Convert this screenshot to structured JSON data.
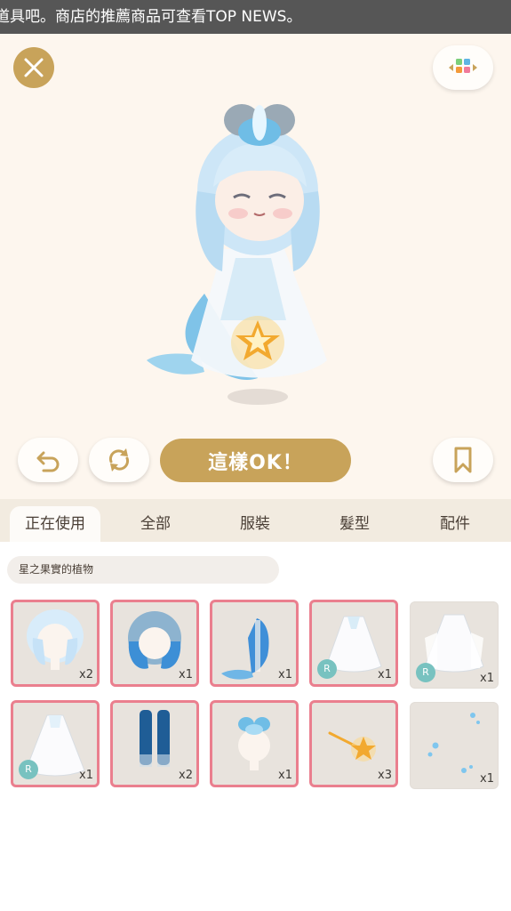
{
  "ticker": {
    "text": "道具吧。商店的推薦商品可查看TOP NEWS。"
  },
  "stage": {
    "close_icon": "close-icon",
    "palette_icon": "palette-grid-icon",
    "undo_icon": "undo-icon",
    "refresh_icon": "refresh-icon",
    "ok_label": "這樣OK！",
    "bookmark_icon": "bookmark-icon"
  },
  "tabs": [
    {
      "label": "正在使用",
      "active": true
    },
    {
      "label": "全部",
      "active": false
    },
    {
      "label": "服裝",
      "active": false
    },
    {
      "label": "髮型",
      "active": false
    },
    {
      "label": "配件",
      "active": false
    }
  ],
  "collection": {
    "label": "星之果實的植物"
  },
  "items": [
    {
      "kind": "hair-short-light",
      "count": "x2",
      "selected": true,
      "badge": ""
    },
    {
      "kind": "hair-blue-gradient",
      "count": "x1",
      "selected": true,
      "badge": ""
    },
    {
      "kind": "mermaid-tail",
      "count": "x1",
      "selected": true,
      "badge": ""
    },
    {
      "kind": "white-dress",
      "count": "x1",
      "selected": true,
      "badge": "R"
    },
    {
      "kind": "white-dress-alt",
      "count": "x1",
      "selected": false,
      "badge": "R"
    },
    {
      "kind": "sheer-gown",
      "count": "x1",
      "selected": true,
      "badge": "R"
    },
    {
      "kind": "blue-stockings",
      "count": "x2",
      "selected": true,
      "badge": ""
    },
    {
      "kind": "shell-hairpiece",
      "count": "x1",
      "selected": true,
      "badge": ""
    },
    {
      "kind": "star-wand",
      "count": "x3",
      "selected": true,
      "badge": ""
    },
    {
      "kind": "bubble-effect",
      "count": "x1",
      "selected": false,
      "badge": ""
    }
  ],
  "colors": {
    "accent": "#c8a35a",
    "selected_border": "#ea7f8e",
    "badge": "#78c2c0",
    "tabbar": "#f2ebe0",
    "stage": "#fdf6ee"
  }
}
